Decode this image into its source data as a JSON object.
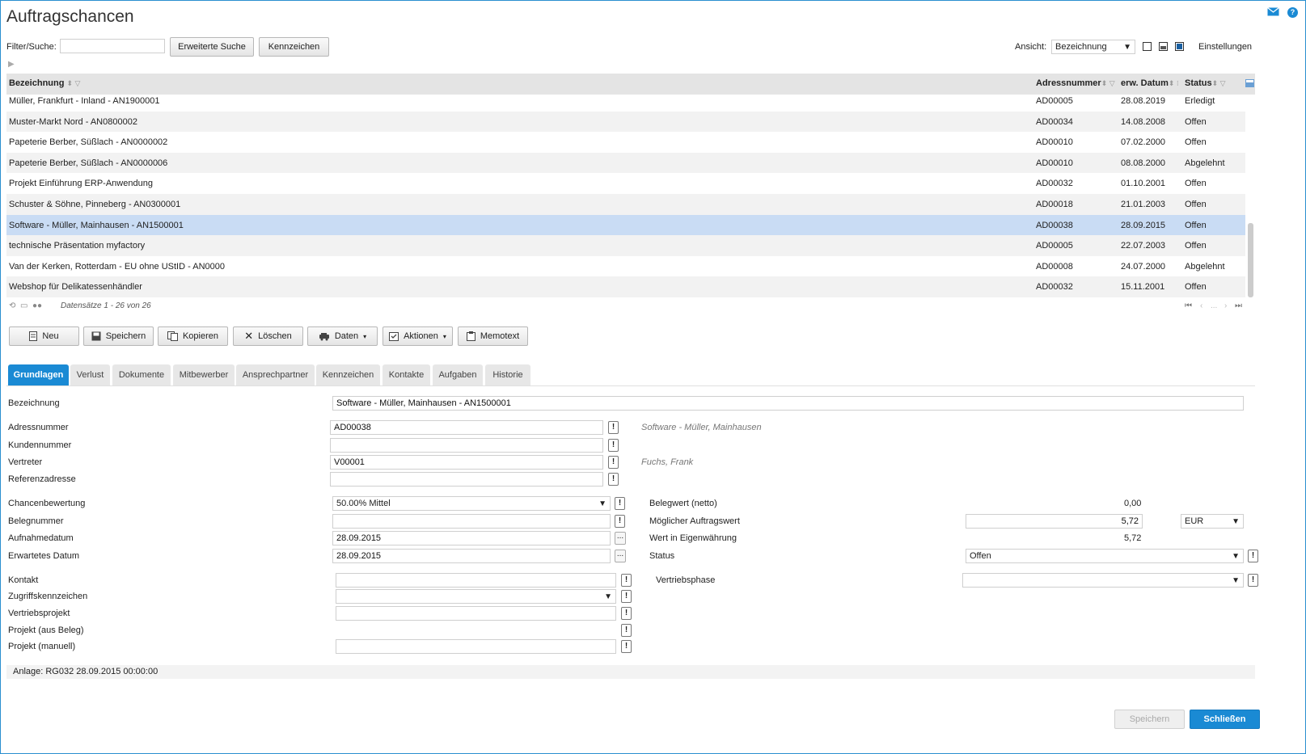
{
  "window": {
    "title": "Auftragschancen"
  },
  "filter": {
    "label": "Filter/Suche:",
    "value": "",
    "extended_search": "Erweiterte Suche",
    "flags_button": "Kennzeichen"
  },
  "view": {
    "label": "Ansicht:",
    "selected": "Bezeichnung",
    "settings": "Einstellungen"
  },
  "grid": {
    "columns": [
      "Bezeichnung",
      "Adressnummer",
      "erw. Datum",
      "Status"
    ],
    "rows": [
      {
        "name": "Müller, Frankfurt - Inland - AN1900001",
        "address": "AD00005",
        "date": "28.08.2019",
        "status": "Erledigt"
      },
      {
        "name": "Muster-Markt Nord - AN0800002",
        "address": "AD00034",
        "date": "14.08.2008",
        "status": "Offen"
      },
      {
        "name": "Papeterie Berber, Süßlach - AN0000002",
        "address": "AD00010",
        "date": "07.02.2000",
        "status": "Offen"
      },
      {
        "name": "Papeterie Berber, Süßlach - AN0000006",
        "address": "AD00010",
        "date": "08.08.2000",
        "status": "Abgelehnt"
      },
      {
        "name": "Projekt Einführung ERP-Anwendung",
        "address": "AD00032",
        "date": "01.10.2001",
        "status": "Offen"
      },
      {
        "name": "Schuster & Söhne, Pinneberg - AN0300001",
        "address": "AD00018",
        "date": "21.01.2003",
        "status": "Offen"
      },
      {
        "name": "Software - Müller, Mainhausen - AN1500001",
        "address": "AD00038",
        "date": "28.09.2015",
        "status": "Offen"
      },
      {
        "name": "technische Präsentation myfactory",
        "address": "AD00005",
        "date": "22.07.2003",
        "status": "Offen"
      },
      {
        "name": "Van der Kerken, Rotterdam - EU ohne UStID - AN0000",
        "address": "AD00008",
        "date": "24.07.2000",
        "status": "Abgelehnt"
      },
      {
        "name": "Webshop für Delikatessenhändler",
        "address": "AD00032",
        "date": "15.11.2001",
        "status": "Offen"
      }
    ],
    "selected_index": 6,
    "record_info": "Datensätze 1 - 26 von 26",
    "pager_ellipsis": "..."
  },
  "toolbar": {
    "new": "Neu",
    "save": "Speichern",
    "copy": "Kopieren",
    "delete": "Löschen",
    "data": "Daten",
    "actions": "Aktionen",
    "memo": "Memotext"
  },
  "tabs": [
    "Grundlagen",
    "Verlust",
    "Dokumente",
    "Mitbewerber",
    "Ansprechpartner",
    "Kennzeichen",
    "Kontakte",
    "Aufgaben",
    "Historie"
  ],
  "form": {
    "bezeichnung_label": "Bezeichnung",
    "bezeichnung_value": "Software - Müller, Mainhausen - AN1500001",
    "adressnummer_label": "Adressnummer",
    "adressnummer_value": "AD00038",
    "adressnummer_hint": "Software - Müller, Mainhausen",
    "kundennummer_label": "Kundennummer",
    "kundennummer_value": "",
    "vertreter_label": "Vertreter",
    "vertreter_value": "V00001",
    "vertreter_hint": "Fuchs, Frank",
    "referenzadresse_label": "Referenzadresse",
    "referenzadresse_value": "",
    "chancen_label": "Chancenbewertung",
    "chancen_value": "50.00% Mittel",
    "belegnummer_label": "Belegnummer",
    "belegnummer_value": "",
    "aufnahmedatum_label": "Aufnahmedatum",
    "aufnahmedatum_value": "28.09.2015",
    "erwartet_label": "Erwartetes Datum",
    "erwartet_value": "28.09.2015",
    "belegwert_label": "Belegwert (netto)",
    "belegwert_value": "0,00",
    "moeglich_label": "Möglicher Auftragswert",
    "moeglich_value": "5,72",
    "currency": "EUR",
    "eigenwaehrung_label": "Wert in Eigenwährung",
    "eigenwaehrung_value": "5,72",
    "status_label": "Status",
    "status_value": "Offen",
    "kontakt_label": "Kontakt",
    "kontakt_value": "",
    "zugriff_label": "Zugriffskennzeichen",
    "zugriff_value": "",
    "vertriebsprojekt_label": "Vertriebsprojekt",
    "vertriebsprojekt_value": "",
    "projekt_beleg_label": "Projekt (aus Beleg)",
    "projekt_manuell_label": "Projekt (manuell)",
    "projekt_manuell_value": "",
    "vertriebsphase_label": "Vertriebsphase",
    "vertriebsphase_value": "",
    "anlage": "Anlage: RG032 28.09.2015 00:00:00",
    "exclaim": "!",
    "dots": "..."
  },
  "footer": {
    "save": "Speichern",
    "close": "Schließen"
  },
  "colors": {
    "accent": "#1a8ad4",
    "selected_row": "#c9dcf4",
    "header_bg": "#e4e4e4"
  },
  "icons": [
    "mail-icon",
    "help-icon",
    "refresh-icon",
    "print-icon",
    "columns-icon",
    "filter-icon",
    "sort-icon",
    "export-icon"
  ]
}
